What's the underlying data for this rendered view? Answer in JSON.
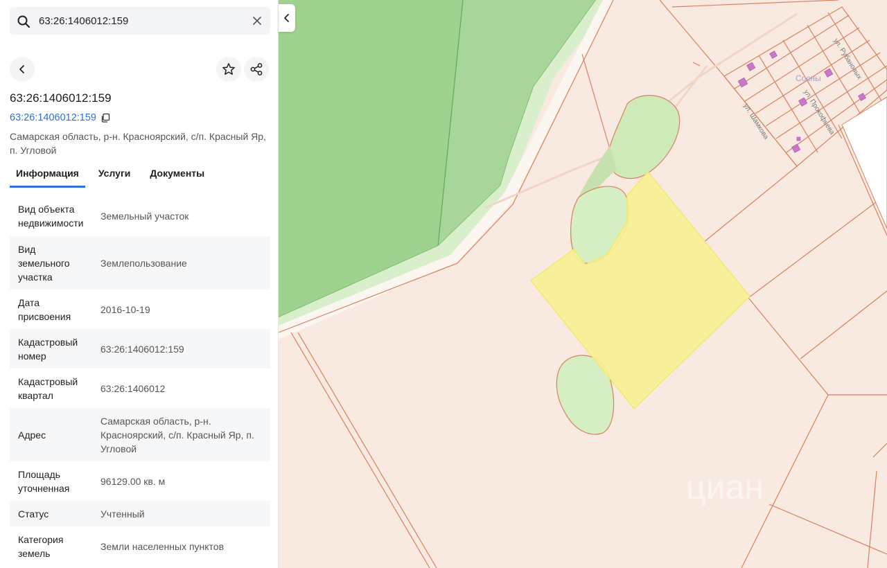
{
  "search": {
    "value": "63:26:1406012:159"
  },
  "card": {
    "title": "63:26:1406012:159",
    "link_text": "63:26:1406012:159",
    "address_line1": "Самарская область, р-н. Красноярский, с/п. Красный Яр,",
    "address_line2": "п. Угловой"
  },
  "tabs": [
    {
      "label": "Информация"
    },
    {
      "label": "Услуги"
    },
    {
      "label": "Документы"
    }
  ],
  "info": [
    {
      "k1": "Вид объекта",
      "k2": "недвижимости",
      "k3": "",
      "v1": "Земельный участок",
      "v2": "",
      "v3": ""
    },
    {
      "k1": "Вид",
      "k2": "земельного",
      "k3": "участка",
      "v1": "Землепользование",
      "v2": "",
      "v3": ""
    },
    {
      "k1": "Дата",
      "k2": "присвоения",
      "k3": "",
      "v1": "2016-10-19",
      "v2": "",
      "v3": ""
    },
    {
      "k1": "Кадастровый",
      "k2": "номер",
      "k3": "",
      "v1": "63:26:1406012:159",
      "v2": "",
      "v3": ""
    },
    {
      "k1": "Кадастровый",
      "k2": "квартал",
      "k3": "",
      "v1": "63:26:1406012",
      "v2": "",
      "v3": ""
    },
    {
      "k1": "Адрес",
      "k2": "",
      "k3": "",
      "v1": "Самарская область, р-н.",
      "v2": "Красноярский, с/п. Красный Яр, п.",
      "v3": "Угловой"
    },
    {
      "k1": "Площадь",
      "k2": "уточненная",
      "k3": "",
      "v1": "96129.00 кв. м",
      "v2": "",
      "v3": ""
    },
    {
      "k1": "Статус",
      "k2": "",
      "k3": "",
      "v1": "Учтенный",
      "v2": "",
      "v3": ""
    },
    {
      "k1": "Категория",
      "k2": "земель",
      "k3": "",
      "v1": "Земли населенных пунктов",
      "v2": "",
      "v3": ""
    }
  ],
  "map": {
    "place_name": "Сосны",
    "streets": {
      "s1": "ул. Шамкова",
      "s2": "ул. Прокофьева",
      "s3": "ул. Рубановых"
    },
    "watermark": "циан"
  },
  "icons": {
    "search": "search-icon",
    "clear": "close-icon",
    "back": "chevron-left-icon",
    "favorite": "star-icon",
    "share": "share-icon",
    "copy": "copy-icon",
    "collapse": "chevron-left-icon"
  },
  "colors": {
    "accent": "#2e6fd8",
    "forest": "#8fca84",
    "parcel_highlight": "#f7ef94",
    "parcel_border": "#d9805f",
    "land": "#f8e9e1"
  }
}
